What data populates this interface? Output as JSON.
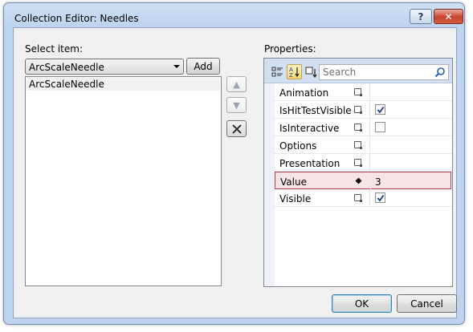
{
  "window": {
    "title": "Collection Editor: Needles",
    "help_label": "?",
    "close_label": "✕"
  },
  "left": {
    "select_label": "Select item:",
    "combo_value": "ArcScaleNeedle",
    "add_label": "Add",
    "items": [
      "ArcScaleNeedle"
    ]
  },
  "side_buttons": {
    "up": "▲",
    "down": "▼",
    "delete": "✕"
  },
  "right": {
    "properties_label": "Properties:",
    "search_placeholder": "Search",
    "toolbar_icons": [
      "categorized-icon",
      "alphabetical-sort-icon",
      "property-view-icon"
    ],
    "rows": [
      {
        "name": "Animation",
        "checkbox": null,
        "value": ""
      },
      {
        "name": "IsHitTestVisible",
        "checkbox": true,
        "value": ""
      },
      {
        "name": "IsInteractive",
        "checkbox": false,
        "value": ""
      },
      {
        "name": "Options",
        "checkbox": null,
        "value": ""
      },
      {
        "name": "Presentation",
        "checkbox": null,
        "value": ""
      },
      {
        "name": "Value",
        "checkbox": null,
        "value": "3"
      },
      {
        "name": "Visible",
        "checkbox": true,
        "value": ""
      }
    ]
  },
  "footer": {
    "ok_label": "OK",
    "cancel_label": "Cancel"
  },
  "colors": {
    "accent_border": "#b2404e",
    "highlight_bg": "#f7e4e7",
    "toolbar_bg": "#d2dff0"
  }
}
